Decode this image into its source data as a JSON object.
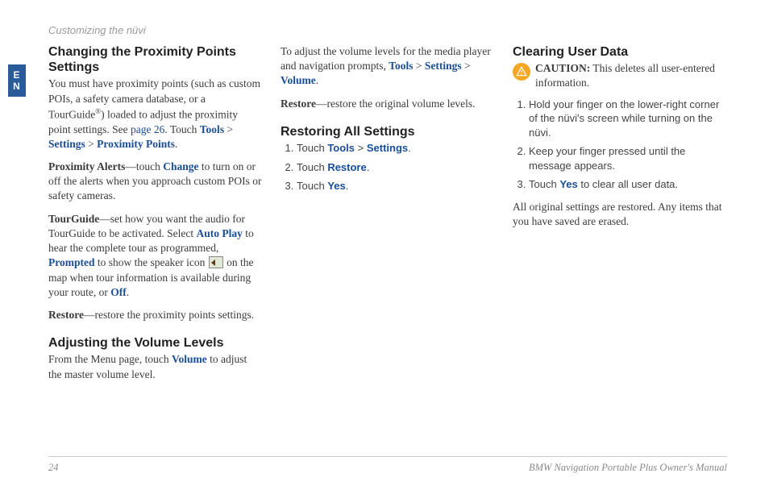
{
  "runningHead": "Customizing the nüvi",
  "langTab": "E\nN",
  "col1": {
    "h1": "Changing the Proximity Points Settings",
    "p1a": "You must have proximity points (such as custom POIs, a safety camera database, or a TourGuide",
    "reg": "®",
    "p1b": ") loaded to adjust the proximity point settings. See ",
    "pageRef": "page 26",
    "p1c": ". Touch ",
    "k1": "Tools",
    "gt1": " > ",
    "k2": "Settings",
    "gt2": " > ",
    "k3": "Proximity Points",
    "dot1": ".",
    "paLabel": "Proximity Alerts",
    "paDash": "—touch ",
    "paChange": "Change",
    "paRest": " to turn on or off the alerts when you approach custom POIs or safety cameras.",
    "tgLabel": "TourGuide",
    "tgDash": "—set how you want the audio for TourGuide to be activated. Select ",
    "tgAuto": "Auto Play",
    "tgMid1": " to hear the complete tour as programmed, ",
    "tgPrompted": "Prompted",
    "tgMid2": " to show the speaker icon ",
    "tgMid3": " on the map when tour information is available during your route, or ",
    "tgOff": "Off",
    "tgDot": ".",
    "rLabel": "Restore",
    "rDash": "—restore the proximity points settings.",
    "h2": "Adjusting the Volume Levels",
    "p2a": "From the Menu page, touch ",
    "p2Vol": "Volume",
    "p2b": " to adjust the master volume level."
  },
  "col2": {
    "p1a": "To adjust the volume levels for the media player and navigation prompts, ",
    "k1": "Tools",
    "gt1": " > ",
    "k2": "Settings",
    "gt2": " > ",
    "k3": "Volume",
    "dot": ".",
    "rLabel": "Restore",
    "rDash": "—restore the original volume levels.",
    "h1": "Restoring All Settings",
    "s1a": "Touch ",
    "s1k1": "Tools",
    "s1gt": " > ",
    "s1k2": "Settings",
    "s1dot": ".",
    "s2a": "Touch ",
    "s2k": "Restore",
    "s2dot": ".",
    "s3a": "Touch ",
    "s3k": "Yes",
    "s3dot": "."
  },
  "col3": {
    "h1": "Clearing User Data",
    "cautionLabel": "CAUTION:",
    "cautionText": " This deletes all user-entered information.",
    "s1": "Hold your finger on the lower-right corner of the nüvi's screen while turning on the nüvi.",
    "s2": "Keep your finger pressed until the message appears.",
    "s3a": "Touch ",
    "s3k": "Yes",
    "s3b": " to clear all user data.",
    "pEnd": "All original settings are restored. Any items that you have saved are erased."
  },
  "footer": {
    "pageNum": "24",
    "manual": "BMW Navigation Portable Plus Owner's Manual"
  }
}
